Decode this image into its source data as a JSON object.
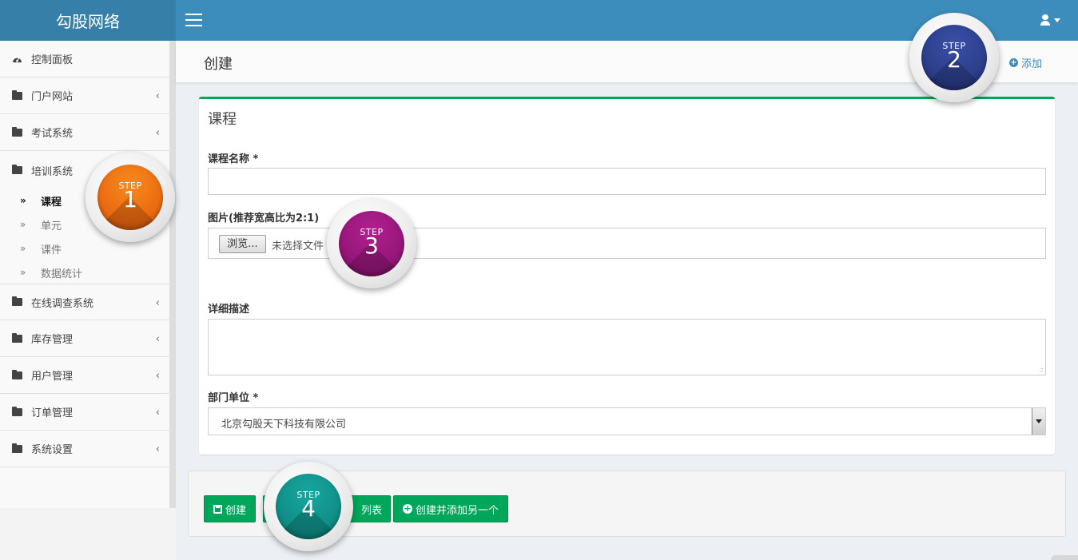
{
  "brand": {
    "logo_text": "勾股网络"
  },
  "header": {
    "user_icon": "user-icon"
  },
  "sidebar": {
    "items": [
      {
        "label": "控制面板",
        "icon": "dashboard-icon"
      },
      {
        "label": "门户网站",
        "icon": "folder-icon"
      },
      {
        "label": "考试系统",
        "icon": "folder-icon"
      },
      {
        "label": "培训系统",
        "icon": "folder-open-icon"
      },
      {
        "label": "在线调查系统",
        "icon": "folder-icon"
      },
      {
        "label": "库存管理",
        "icon": "folder-icon"
      },
      {
        "label": "用户管理",
        "icon": "folder-icon"
      },
      {
        "label": "订单管理",
        "icon": "folder-icon"
      },
      {
        "label": "系统设置",
        "icon": "folder-icon"
      }
    ],
    "sub_items": [
      {
        "label": "课程",
        "active": true
      },
      {
        "label": "单元",
        "active": false
      },
      {
        "label": "课件",
        "active": false
      },
      {
        "label": "数据统计",
        "active": false
      }
    ],
    "chevron": "‹",
    "sub_marker": "»"
  },
  "content_header": {
    "title": "创建",
    "add_label": "添加"
  },
  "form": {
    "box_title": "课程",
    "name_label": "课程名称 *",
    "name_value": "",
    "image_label": "图片(推荐宽高比为2:1)",
    "browse_label": "浏览...",
    "no_file_text": "未选择文件",
    "desc_label": "详细描述",
    "desc_value": "",
    "dept_label": "部门单位 *",
    "dept_value": "北京勾股天下科技有限公司"
  },
  "footer": {
    "create_label": "创建",
    "list_label_visible": "列表",
    "create_add_label": "创建并添加另一个"
  },
  "steps": [
    {
      "word": "STEP",
      "num": "1",
      "color": "#f07a14"
    },
    {
      "word": "STEP",
      "num": "2",
      "color": "#2d3f90"
    },
    {
      "word": "STEP",
      "num": "3",
      "color": "#9c1a7e"
    },
    {
      "word": "STEP",
      "num": "4",
      "color": "#11968f"
    }
  ],
  "colors": {
    "topbar": "#3c8dbc",
    "logo_bg": "#367fa9",
    "success": "#00a65a"
  }
}
